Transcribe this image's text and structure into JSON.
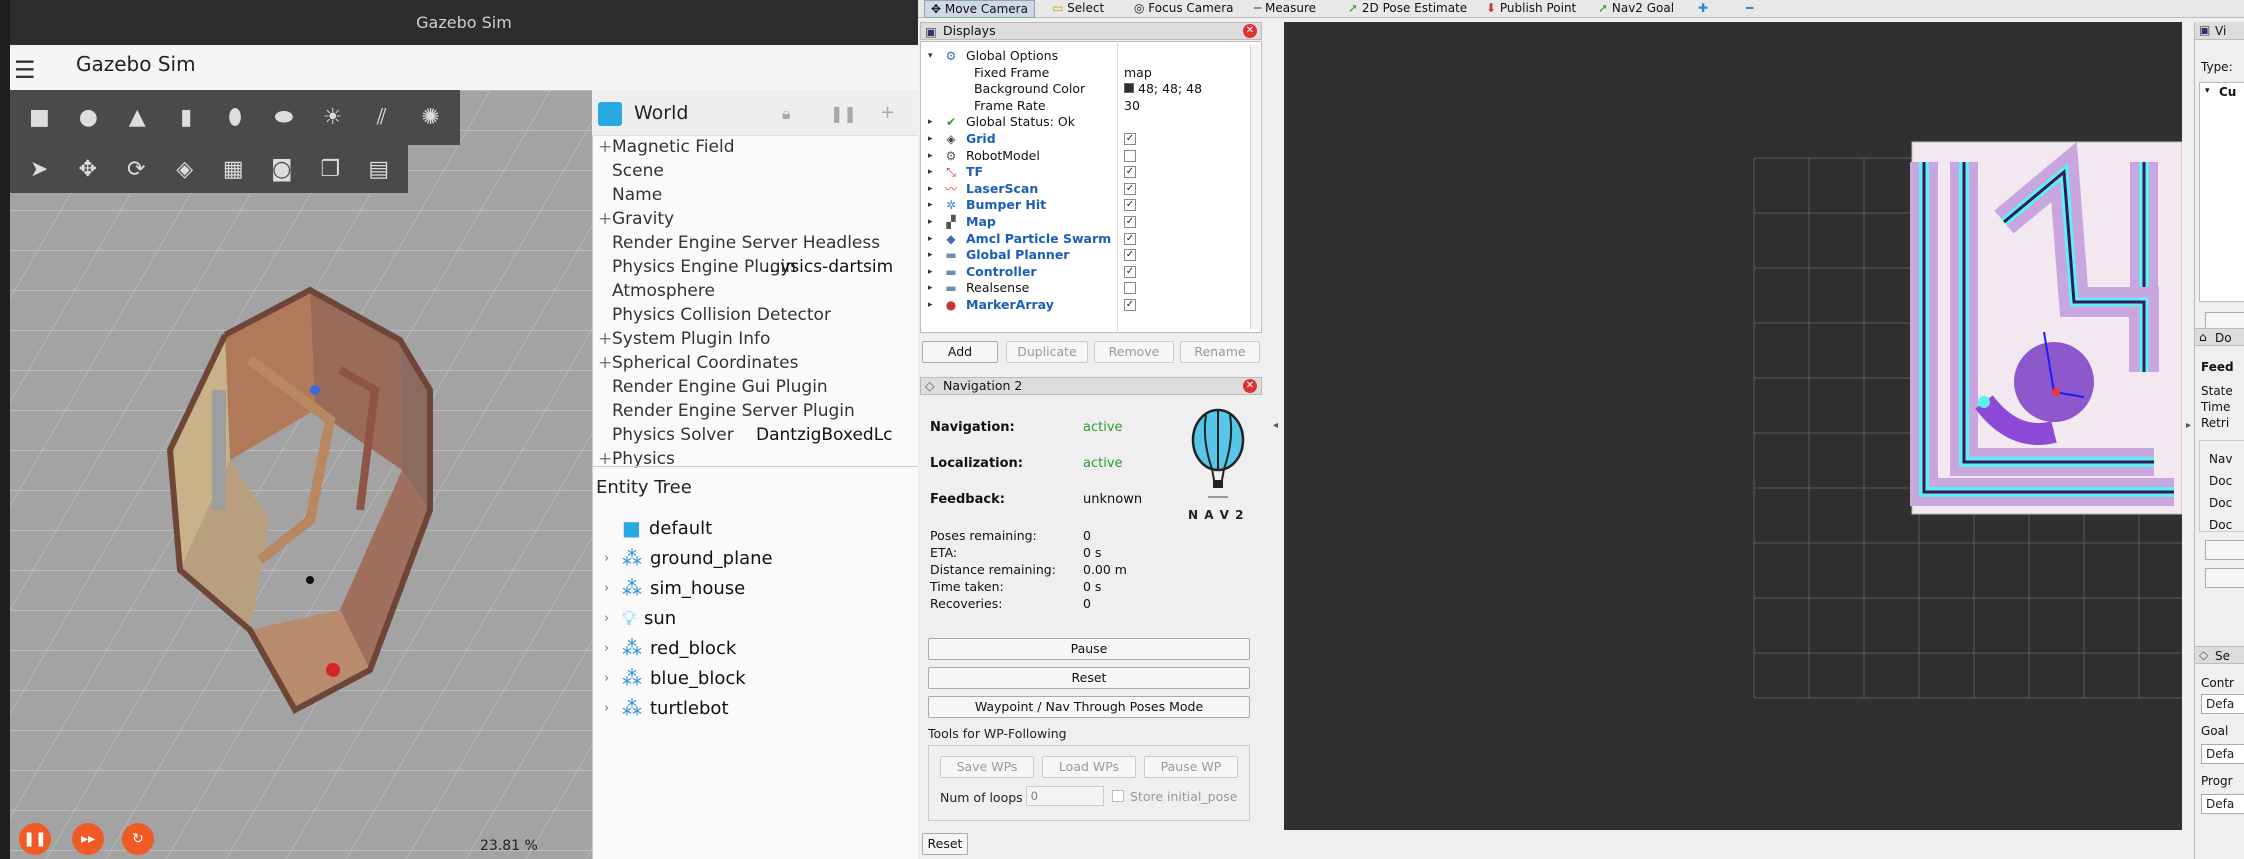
{
  "gazebo": {
    "window_title": "Gazebo Sim",
    "app_title": "Gazebo Sim",
    "menu_icon": "hamburger-icon",
    "shape_tools": [
      "box-icon",
      "sphere-icon",
      "cone-icon",
      "cylinder-icon",
      "capsule-icon",
      "ellipsoid-icon",
      "sun-light-icon",
      "directional-light-icon",
      "spot-light-icon"
    ],
    "transform_tools": [
      "select-icon",
      "translate-icon",
      "rotate-icon",
      "snap-icon",
      "grid-icon",
      "camera-icon",
      "copy-icon",
      "paste-icon"
    ],
    "component_inspector": {
      "entity": "World",
      "properties": [
        {
          "label": "Magnetic Field",
          "expandable": true,
          "value": ""
        },
        {
          "label": "Scene",
          "expandable": false,
          "value": ""
        },
        {
          "label": "Name",
          "expandable": false,
          "value": ""
        },
        {
          "label": "Gravity",
          "expandable": true,
          "value": ""
        },
        {
          "label": "Render Engine Server Headless",
          "expandable": false,
          "value": ""
        },
        {
          "label": "Physics Engine Plugin",
          "expandable": false,
          "value": "...ysics-dartsim"
        },
        {
          "label": "Atmosphere",
          "expandable": false,
          "value": ""
        },
        {
          "label": "Physics Collision Detector",
          "expandable": false,
          "value": ""
        },
        {
          "label": "System Plugin Info",
          "expandable": true,
          "value": ""
        },
        {
          "label": "Spherical Coordinates",
          "expandable": true,
          "value": ""
        },
        {
          "label": "Render Engine Gui Plugin",
          "expandable": false,
          "value": ""
        },
        {
          "label": "Render Engine Server Plugin",
          "expandable": false,
          "value": ""
        },
        {
          "label": "Physics Solver",
          "expandable": false,
          "value": "DantzigBoxedLc"
        },
        {
          "label": "Physics",
          "expandable": true,
          "value": ""
        }
      ]
    },
    "entity_tree": {
      "title": "Entity Tree",
      "items": [
        {
          "name": "default",
          "icon": "world-cube-icon",
          "expandable": false
        },
        {
          "name": "ground_plane",
          "icon": "model-icon",
          "expandable": true
        },
        {
          "name": "sim_house",
          "icon": "model-icon",
          "expandable": true
        },
        {
          "name": "sun",
          "icon": "light-bulb-icon",
          "expandable": true
        },
        {
          "name": "red_block",
          "icon": "model-icon",
          "expandable": true
        },
        {
          "name": "blue_block",
          "icon": "model-icon",
          "expandable": true
        },
        {
          "name": "turtlebot",
          "icon": "model-icon",
          "expandable": true
        }
      ]
    },
    "rtf": "23.81 %"
  },
  "rviz": {
    "toolbar": [
      "Move Camera",
      "Select",
      "Focus Camera",
      "Measure",
      "2D Pose Estimate",
      "Publish Point",
      "Nav2 Goal"
    ],
    "displays": {
      "title": "Displays",
      "rows": [
        {
          "label": "Global Options",
          "icon": "gear-icon",
          "expanded": true,
          "bold": false
        },
        {
          "label": "Fixed Frame",
          "sub": true,
          "value": "map"
        },
        {
          "label": "Background Color",
          "sub": true,
          "value": "48; 48; 48",
          "swatch": "#303030"
        },
        {
          "label": "Frame Rate",
          "sub": true,
          "value": "30"
        },
        {
          "label": "Global Status: Ok",
          "icon": "check-icon",
          "bold": false
        },
        {
          "label": "Grid",
          "icon": "grid-icon",
          "bold": true,
          "checked": true
        },
        {
          "label": "RobotModel",
          "icon": "robot-icon",
          "bold": false,
          "checked": false
        },
        {
          "label": "TF",
          "icon": "tf-icon",
          "bold": true,
          "checked": true
        },
        {
          "label": "LaserScan",
          "icon": "laser-icon",
          "bold": true,
          "checked": true
        },
        {
          "label": "Bumper Hit",
          "icon": "bumper-icon",
          "bold": true,
          "checked": true
        },
        {
          "label": "Map",
          "icon": "map-icon",
          "bold": true,
          "checked": true
        },
        {
          "label": "Amcl Particle Swarm",
          "icon": "particle-icon",
          "bold": true,
          "checked": true
        },
        {
          "label": "Global Planner",
          "icon": "folder-icon",
          "bold": true,
          "checked": true
        },
        {
          "label": "Controller",
          "icon": "folder-icon",
          "bold": true,
          "checked": true
        },
        {
          "label": "Realsense",
          "icon": "folder-icon",
          "bold": false,
          "checked": false
        },
        {
          "label": "MarkerArray",
          "icon": "marker-icon",
          "bold": true,
          "checked": true
        }
      ],
      "buttons": {
        "add": "Add",
        "duplicate": "Duplicate",
        "remove": "Remove",
        "rename": "Rename"
      }
    },
    "nav2": {
      "title": "Navigation 2",
      "navigation_label": "Navigation:",
      "navigation_value": "active",
      "localization_label": "Localization:",
      "localization_value": "active",
      "feedback_label": "Feedback:",
      "feedback_value": "unknown",
      "logo_text": "N A V 2",
      "stats": [
        {
          "label": "Poses remaining:",
          "value": "0"
        },
        {
          "label": "ETA:",
          "value": "0 s"
        },
        {
          "label": "Distance remaining:",
          "value": "0.00 m"
        },
        {
          "label": "Time taken:",
          "value": "0 s"
        },
        {
          "label": "Recoveries:",
          "value": "0"
        }
      ],
      "pause_label": "Pause",
      "reset_label": "Reset",
      "waypoint_label": "Waypoint / Nav Through Poses Mode",
      "wp_group_title": "Tools for WP-Following",
      "save_wps": "Save WPs",
      "load_wps": "Load WPs",
      "pause_wp": "Pause WP",
      "loops_label": "Num of loops",
      "loops_placeholder": "0",
      "store_initial": "Store initial_pose"
    },
    "bottom_reset": "Reset",
    "right_panel": {
      "views_title": "Vi",
      "type_label": "Type:",
      "current_label": "Cu",
      "docking_title": "Do",
      "feedback_label": "Feed",
      "state": "State",
      "time": "Time",
      "retries": "Retri",
      "nav_label": "Nav",
      "doc1": "Doc",
      "doc2": "Doc",
      "doc3": "Doc",
      "sel_title": "Se",
      "controller_label": "Contr",
      "default1": "Defa",
      "goal_label": "Goal",
      "default2": "Defa",
      "progress_label": "Progr",
      "default3": "Defa"
    }
  }
}
